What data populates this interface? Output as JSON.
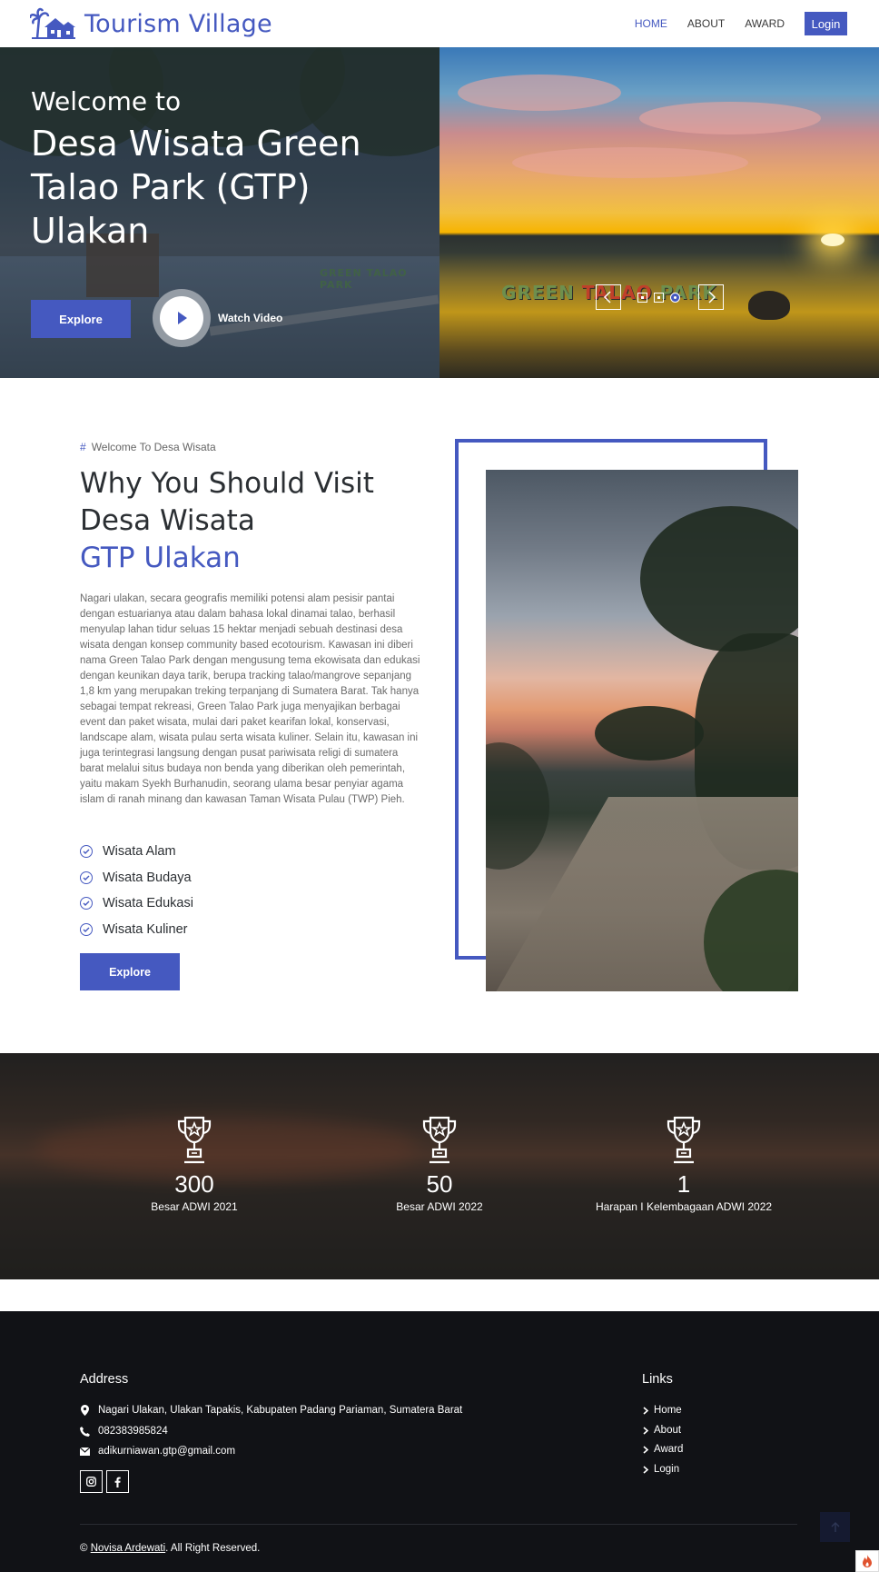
{
  "header": {
    "brand": "Tourism Village",
    "nav": [
      "HOME",
      "ABOUT",
      "AWARD"
    ],
    "login": "Login",
    "active_nav": "HOME"
  },
  "hero": {
    "welcome": "Welcome to",
    "title": "Desa Wisata Green Talao Park (GTP) Ulakan",
    "explore": "Explore",
    "watch_video": "Watch Video",
    "sign_text_left": "GREEN",
    "sign_text_mid": "TALAO",
    "sign_text_right": "PARK",
    "small_sign": "GREEN TALAO PARK",
    "slider_total": 3,
    "slider_active": 3
  },
  "about": {
    "tag": "Welcome To Desa Wisata",
    "title_line1": "Why You Should Visit",
    "title_line2": "Desa Wisata",
    "title_accent": "GTP Ulakan",
    "description": "Nagari ulakan, secara geografis memiliki potensi alam pesisir pantai dengan estuarianya atau dalam bahasa lokal dinamai talao, berhasil menyulap lahan tidur seluas 15 hektar menjadi sebuah destinasi desa wisata dengan konsep community based ecotourism. Kawasan ini diberi nama Green Talao Park dengan mengusung tema ekowisata dan edukasi dengan keunikan daya tarik, berupa tracking talao/mangrove sepanjang 1,8 km yang merupakan treking terpanjang di Sumatera Barat. Tak hanya sebagai tempat rekreasi, Green Talao Park juga menyajikan berbagai event dan paket wisata, mulai dari paket kearifan lokal, konservasi, landscape alam, wisata pulau serta wisata kuliner. Selain itu, kawasan ini juga terintegrasi langsung dengan pusat pariwisata religi di sumatera barat melalui situs budaya non benda yang diberikan oleh pemerintah, yaitu makam Syekh Burhanudin, seorang ulama besar penyiar agama islam di ranah minang dan kawasan Taman Wisata Pulau (TWP) Pieh.",
    "features": [
      "Wisata Alam",
      "Wisata Budaya",
      "Wisata Edukasi",
      "Wisata Kuliner"
    ],
    "explore": "Explore"
  },
  "stats": [
    {
      "value": "300",
      "label": "Besar ADWI 2021"
    },
    {
      "value": "50",
      "label": "Besar ADWI 2022"
    },
    {
      "value": "1",
      "label": "Harapan I Kelembagaan ADWI 2022"
    }
  ],
  "footer": {
    "address_heading": "Address",
    "address": "Nagari Ulakan, Ulakan Tapakis, Kabupaten Padang Pariaman, Sumatera Barat",
    "phone": "082383985824",
    "email": "adikurniawan.gtp@gmail.com",
    "links_heading": "Links",
    "links": [
      "Home",
      "About",
      "Award",
      "Login"
    ],
    "copyright_prefix": "©",
    "copyright_author": "Novisa Ardewati",
    "copyright_suffix": ". All Right Reserved."
  },
  "colors": {
    "accent": "#4559c0",
    "footer_bg": "#111216",
    "text_dark": "#2b2f33"
  }
}
